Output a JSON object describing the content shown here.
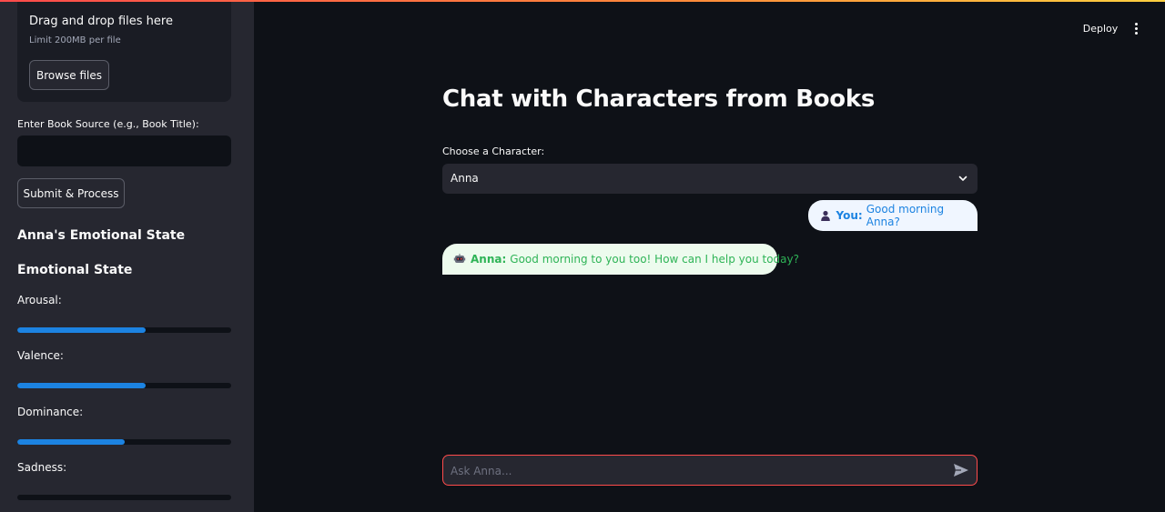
{
  "sidebar": {
    "uploader": {
      "drag_text": "Drag and drop files here",
      "limit_text": "Limit 200MB per file",
      "browse_label": "Browse files"
    },
    "book_source": {
      "label": "Enter Book Source (e.g., Book Title):",
      "value": ""
    },
    "submit_label": "Submit & Process",
    "emotional_heading": "Anna's Emotional State",
    "state_heading": "Emotional State",
    "metrics": [
      {
        "label": "Arousal:",
        "value": 0.6
      },
      {
        "label": "Valence:",
        "value": 0.6
      },
      {
        "label": "Dominance:",
        "value": 0.5
      },
      {
        "label": "Sadness:",
        "value": 0.0
      }
    ]
  },
  "header": {
    "deploy_label": "Deploy",
    "menu_icon": "kebab-menu-icon"
  },
  "main": {
    "title": "Chat with Characters from Books",
    "character_label": "Choose a Character:",
    "character_selected": "Anna",
    "messages": [
      {
        "speaker": "You:",
        "text": "Good morning Anna?",
        "icon": "user-icon"
      },
      {
        "speaker": "Anna:",
        "text": "Good morning to you too! How can I help you today?",
        "icon": "robot-icon"
      }
    ],
    "chat_placeholder": "Ask Anna..."
  },
  "colors": {
    "accent": "#1c83e1",
    "bot_text": "#2fb457",
    "input_border": "#ff4b4b",
    "sidebar_bg": "#262730",
    "main_bg": "#0e1117"
  }
}
